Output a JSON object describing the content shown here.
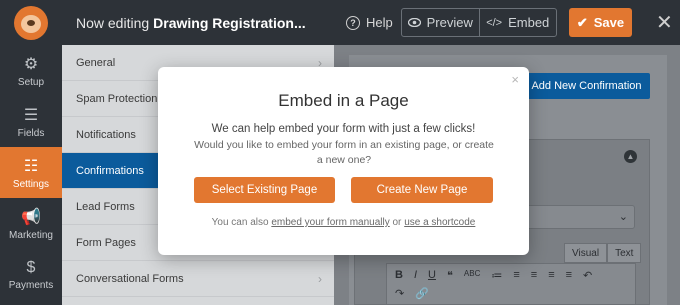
{
  "topbar": {
    "editing_prefix": "Now editing",
    "form_name": "Drawing Registration...",
    "help_label": "Help",
    "preview_label": "Preview",
    "embed_label": "Embed",
    "save_label": "Save",
    "close_symbol": "✕"
  },
  "leftnav": {
    "items": [
      {
        "label": "Setup",
        "icon": "gear-icon",
        "active": false
      },
      {
        "label": "Fields",
        "icon": "fields-icon",
        "active": false
      },
      {
        "label": "Settings",
        "icon": "sliders-icon",
        "active": true
      },
      {
        "label": "Marketing",
        "icon": "megaphone-icon",
        "active": false
      },
      {
        "label": "Payments",
        "icon": "dollar-icon",
        "active": false
      }
    ]
  },
  "submenu": {
    "items": [
      {
        "label": "General",
        "active": false
      },
      {
        "label": "Spam Protection an",
        "active": false
      },
      {
        "label": "Notifications",
        "active": false
      },
      {
        "label": "Confirmations",
        "active": true
      },
      {
        "label": "Lead Forms",
        "active": false
      },
      {
        "label": "Form Pages",
        "active": false
      },
      {
        "label": "Conversational Forms",
        "active": false
      }
    ]
  },
  "rightpanel": {
    "add_confirmation_label": "Add New Confirmation",
    "editor_tabs": [
      "Visual",
      "Text"
    ]
  },
  "modal": {
    "title": "Embed in a Page",
    "lead": "We can help embed your form with just a few clicks!",
    "sub": "Would you like to embed your form in an existing page, or create a new one?",
    "btn_existing": "Select Existing Page",
    "btn_new": "Create New Page",
    "foot_prefix": "You can also",
    "foot_link1": "embed your form manually",
    "foot_or": "or",
    "foot_link2": "use a shortcode",
    "close_symbol": "×"
  },
  "colors": {
    "accent": "#e27730",
    "primary": "#0b5b9c"
  }
}
